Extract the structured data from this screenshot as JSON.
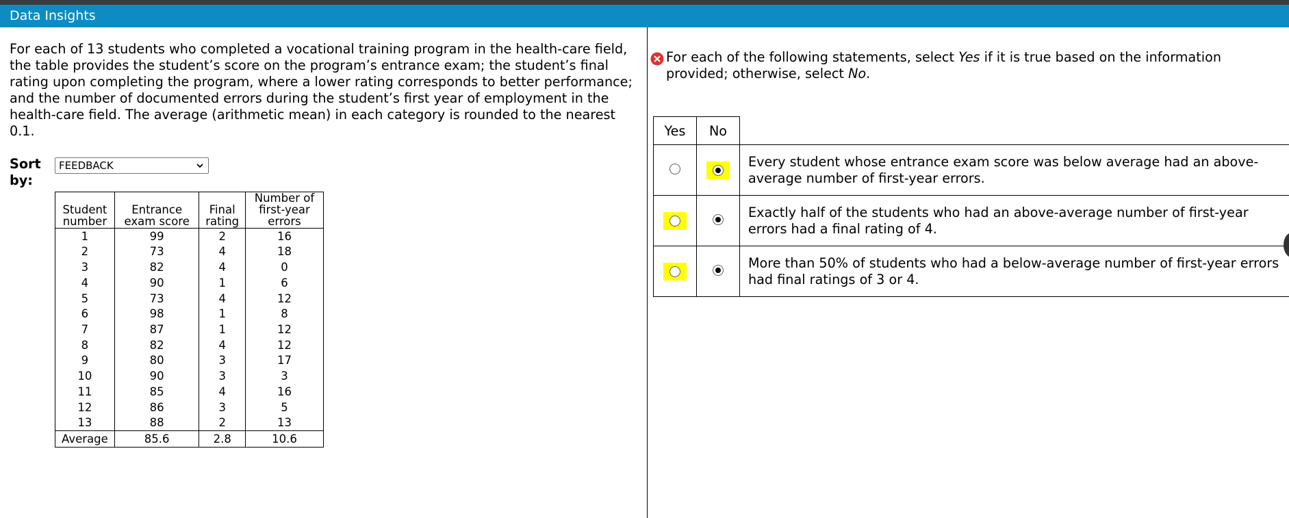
{
  "titlebar": {
    "title": "Data Insights"
  },
  "left": {
    "intro": "For each of 13 students who completed a vocational training program in the health-care field, the table provides the student’s score on the program’s entrance exam; the student’s final rating upon completing the program, where a lower rating corresponds to better performance; and the number of documented errors during the student’s first year of employment in the health-care field. The average (arithmetic mean) in each category is rounded to the nearest 0.1.",
    "sort": {
      "label": "Sort by:",
      "selected": "FEEDBACK"
    },
    "table": {
      "headers": [
        [
          "Student",
          "number"
        ],
        [
          "Entrance",
          "exam score"
        ],
        [
          "Final",
          "rating"
        ],
        [
          "Number of",
          "first-year",
          "errors"
        ]
      ],
      "rows": [
        [
          "1",
          "99",
          "2",
          "16"
        ],
        [
          "2",
          "73",
          "4",
          "18"
        ],
        [
          "3",
          "82",
          "4",
          "0"
        ],
        [
          "4",
          "90",
          "1",
          "6"
        ],
        [
          "5",
          "73",
          "4",
          "12"
        ],
        [
          "6",
          "98",
          "1",
          "8"
        ],
        [
          "7",
          "87",
          "1",
          "12"
        ],
        [
          "8",
          "82",
          "4",
          "12"
        ],
        [
          "9",
          "80",
          "3",
          "17"
        ],
        [
          "10",
          "90",
          "3",
          "3"
        ],
        [
          "11",
          "85",
          "4",
          "16"
        ],
        [
          "12",
          "86",
          "3",
          "5"
        ],
        [
          "13",
          "88",
          "2",
          "13"
        ]
      ],
      "average": [
        "Average",
        "85.6",
        "2.8",
        "10.6"
      ]
    }
  },
  "right": {
    "status_icon": "error-x-icon",
    "prompt": {
      "part1": "For each of the following statements, select ",
      "yes_word": "Yes",
      "part2": " if it is true based on the information provided; otherwise, select ",
      "no_word": "No",
      "part3": "."
    },
    "columns": {
      "yes": "Yes",
      "no": "No"
    },
    "highlight_color": "#ffff00",
    "statements": [
      {
        "text": "Every student whose entrance exam score was below average had an above-average number of first-year errors.",
        "selected": "No",
        "highlight": "No"
      },
      {
        "text": "Exactly half of the students who had an above-average number of first-year errors had a final rating of 4.",
        "selected": "No",
        "highlight": "Yes"
      },
      {
        "text": "More than 50% of students who had a below-average number of first-year errors had final ratings of 3 or 4.",
        "selected": "No",
        "highlight": "Yes"
      }
    ]
  }
}
